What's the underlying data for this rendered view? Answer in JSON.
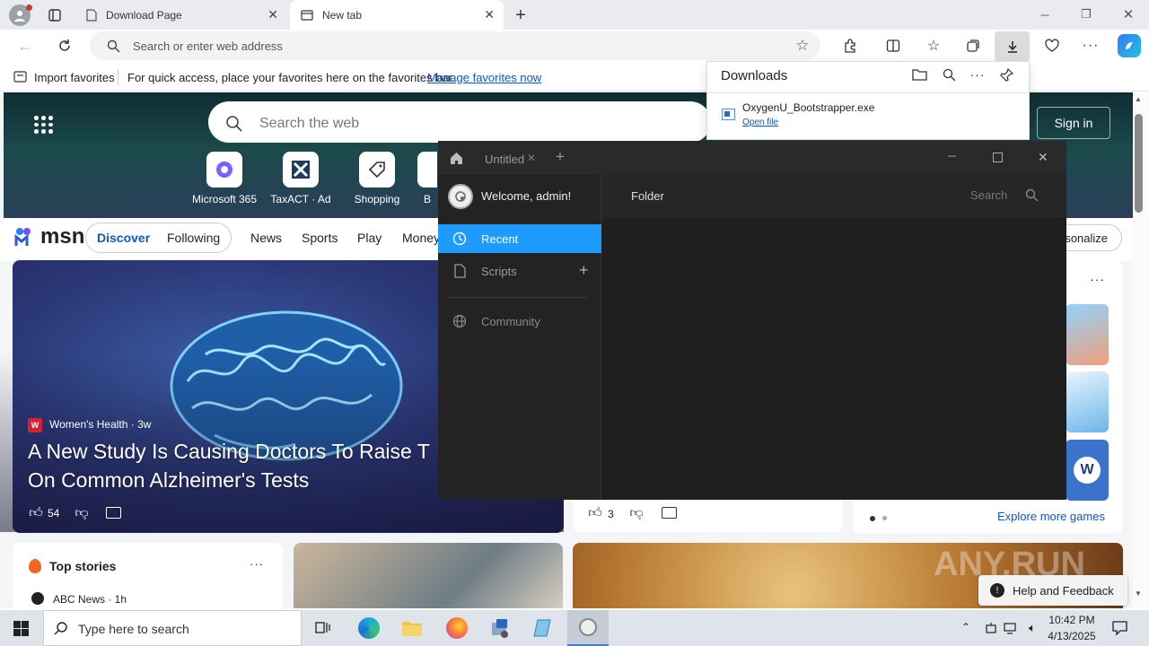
{
  "browser": {
    "tabs": [
      {
        "title": "Download Page"
      },
      {
        "title": "New tab"
      }
    ],
    "address_placeholder": "Search or enter web address",
    "favorites": {
      "import_label": "Import favorites",
      "hint": "For quick access, place your favorites here on the favorites bar.",
      "manage_link": "Manage favorites now"
    }
  },
  "downloads": {
    "title": "Downloads",
    "item": {
      "filename": "OxygenU_Bootstrapper.exe",
      "action": "Open file"
    }
  },
  "newtab": {
    "search_placeholder": "Search the web",
    "sign_in": "Sign in",
    "tiles": [
      {
        "label": "Microsoft 365"
      },
      {
        "label": "TaxACT · Ad"
      },
      {
        "label": "Shopping"
      },
      {
        "label": "B"
      }
    ],
    "logo": "msn",
    "nav": [
      "News",
      "Sports",
      "Play",
      "Money"
    ],
    "feed_tabs": [
      "Discover",
      "Following"
    ],
    "personalize": "rsonalize",
    "hero_story": {
      "source": "Women's Health · 3w",
      "headline": "A New Study Is Causing Doctors To Raise T\nOn Common Alzheimer's Tests",
      "likes": "54"
    },
    "second_card_likes": "3",
    "games_link": "Explore more games",
    "top_stories": {
      "title": "Top stories",
      "first_source": "ABC News · 1h"
    },
    "help": "Help and Feedback",
    "watermark": "ANY.RUN"
  },
  "app_window": {
    "tab_title": "Untitled",
    "welcome": "Welcome, admin!",
    "header_folder": "Folder",
    "search_label": "Search",
    "nav": [
      {
        "label": "Recent",
        "active": true
      },
      {
        "label": "Scripts",
        "active": false
      },
      {
        "label": "Community",
        "active": false
      }
    ],
    "accent": "#1e9bff"
  },
  "taskbar": {
    "search_placeholder": "Type here to search",
    "time": "10:42 PM",
    "date": "4/13/2025"
  }
}
